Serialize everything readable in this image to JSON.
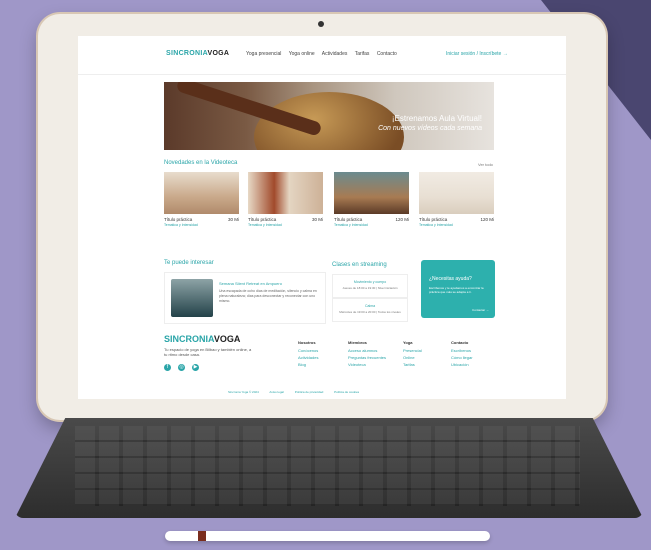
{
  "site": {
    "logo_part1": "SINCRONIA",
    "logo_part2": "VOGA"
  },
  "nav": {
    "items": [
      "Yoga presencial",
      "Yoga online",
      "Actividades",
      "Tarifas",
      "Contacto"
    ],
    "login_label": "Iniciar sesión / Inscríbete →"
  },
  "hero": {
    "title": "¡Estrenamos Aula Virtual!",
    "subtitle": "Con nuevos vídeos cada semana"
  },
  "videoteca": {
    "heading": "Novedades en la Videoteca",
    "more": "Ver todo",
    "cards": [
      {
        "title": "Título práctica",
        "duration": "30 Mi",
        "subtitle": "Tematica y Intensidad"
      },
      {
        "title": "Título práctica",
        "duration": "30 Mi",
        "subtitle": "Tematica y Intensidad"
      },
      {
        "title": "Título práctica",
        "duration": "120 Mi",
        "subtitle": "Tematica y Intensidad"
      },
      {
        "title": "Título práctica",
        "duration": "120 Mi",
        "subtitle": "Tematica y Intensidad"
      }
    ]
  },
  "te_puede": {
    "heading": "Te puede interesar",
    "card_title": "Semana Silent Retreat en Ampuero",
    "card_text": "Una escapada de ocho días de meditación, silencio y calma en plena naturaleza; días para desconectar y reconectar con uno mismo."
  },
  "streaming": {
    "heading": "Clases en streaming",
    "items": [
      {
        "title": "Movimiento y cuerpo",
        "text": "Jueves de 18:00 a 19:30 | Nivel iniciación"
      },
      {
        "title": "Calma",
        "text": "Miércoles de 19:00 a 20:00 | Todos los niveles"
      }
    ]
  },
  "help": {
    "title": "¿Necesitas ayuda?",
    "text": "Escríbenos y te ayudamos a encontrar la práctica que más se adapta a ti.",
    "cta": "Contactar →"
  },
  "footer": {
    "logo_part1": "SINCRONIA",
    "logo_part2": "VOGA",
    "description": "Tu espacio de yoga en Bilbao y también online, a tu ritmo desde casa.",
    "social": [
      "facebook-icon",
      "instagram-icon",
      "youtube-icon"
    ],
    "columns": [
      {
        "heading": "Nosotros",
        "links": [
          "Conócenos",
          "Actividades",
          "Blog"
        ]
      },
      {
        "heading": "Miembros",
        "links": [
          "Acceso alumnos",
          "Preguntas frecuentes",
          "Videoteca"
        ]
      },
      {
        "heading": "Yoga",
        "links": [
          "Presencial",
          "Online",
          "Tarifas"
        ]
      },
      {
        "heading": "Contacto",
        "links": [
          "Escríbenos",
          "Cómo llegar",
          "Ubicación"
        ]
      }
    ],
    "legal": [
      "Sincronía Yoga © 2024",
      "Aviso legal",
      "Política de privacidad",
      "Política de cookies"
    ]
  }
}
